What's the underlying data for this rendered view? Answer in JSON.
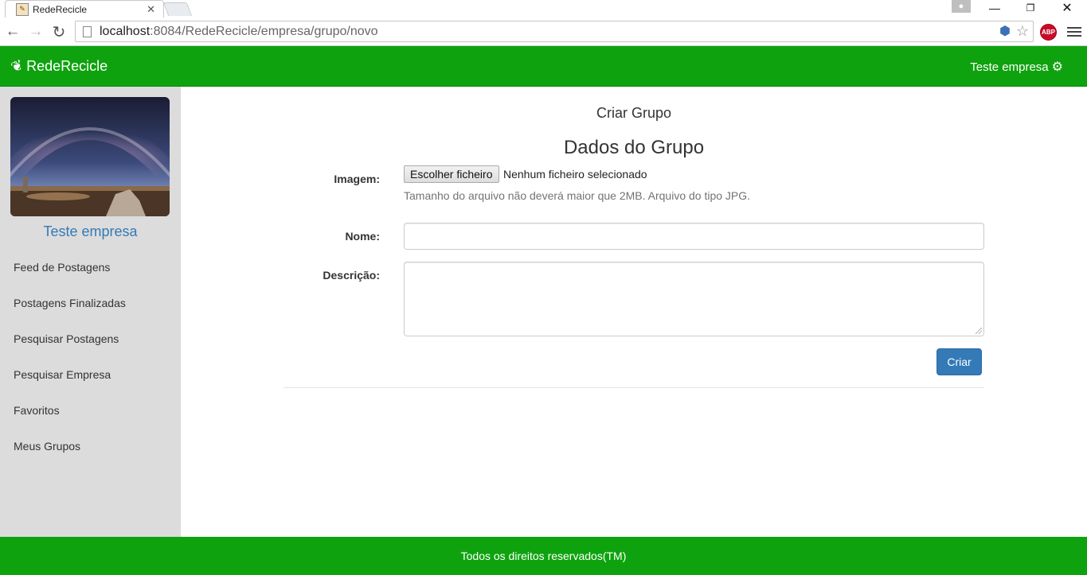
{
  "browser": {
    "tab_title": "RedeRecicle",
    "tab_close": "✕",
    "url_host": "localhost",
    "url_rest": ":8084/RedeRecicle/empresa/grupo/novo",
    "abp_label": "ABP"
  },
  "navbar": {
    "brand": "RedeRecicle",
    "user": "Teste empresa"
  },
  "sidebar": {
    "profile_name": "Teste empresa",
    "items": [
      {
        "label": "Feed de Postagens"
      },
      {
        "label": "Postagens Finalizadas"
      },
      {
        "label": "Pesquisar Postagens"
      },
      {
        "label": "Pesquisar Empresa"
      },
      {
        "label": "Favoritos"
      },
      {
        "label": "Meus Grupos"
      }
    ]
  },
  "form": {
    "subtitle": "Criar Grupo",
    "title": "Dados do Grupo",
    "image_label": "Imagem:",
    "file_button": "Escolher ficheiro",
    "file_status": "Nenhum ficheiro selecionado",
    "file_help": "Tamanho do arquivo não deverá maior que 2MB. Arquivo do tipo JPG.",
    "name_label": "Nome:",
    "name_value": "",
    "description_label": "Descrição:",
    "description_value": "",
    "submit": "Criar"
  },
  "footer": {
    "text": "Todos os direitos reservados(TM)"
  },
  "colors": {
    "brand_green": "#0ea30e",
    "primary_blue": "#337ab7",
    "sidebar_bg": "#dcdcdc"
  }
}
